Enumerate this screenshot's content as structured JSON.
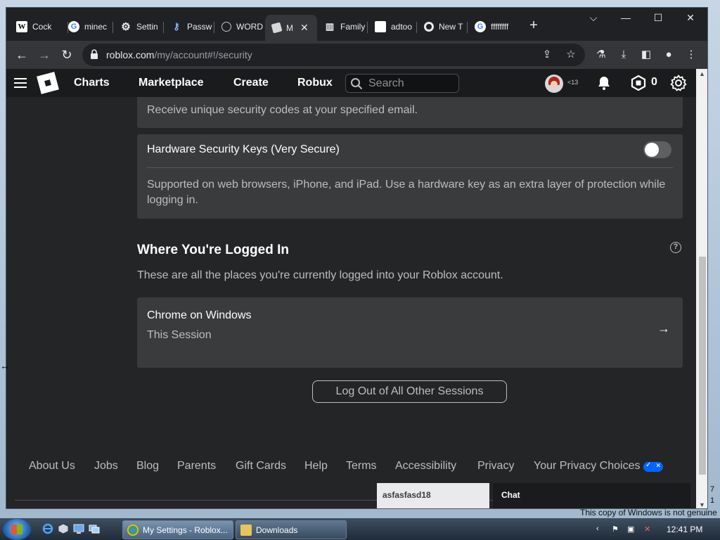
{
  "browser": {
    "tabs": [
      {
        "label": "Cock",
        "icon": "wikipedia-icon"
      },
      {
        "label": "minec",
        "icon": "google-icon"
      },
      {
        "label": "Settin",
        "icon": "gear-icon"
      },
      {
        "label": "Passw",
        "icon": "key-icon"
      },
      {
        "label": "WORD",
        "icon": "globe-icon"
      },
      {
        "label": "M",
        "icon": "roblox-icon",
        "active": true
      },
      {
        "label": "Family",
        "icon": "building-icon"
      },
      {
        "label": "adtoo",
        "icon": "blank-page-icon"
      },
      {
        "label": "New T",
        "icon": "chrome-icon"
      },
      {
        "label": "ffffffff",
        "icon": "google-icon"
      }
    ],
    "url_host": "roblox.com",
    "url_path": "/my/account#!/security"
  },
  "header": {
    "nav": [
      "Charts",
      "Marketplace",
      "Create",
      "Robux"
    ],
    "search_placeholder": "Search",
    "age_label": "<13",
    "robux_count": "0"
  },
  "security": {
    "email_desc": "Receive unique security codes at your specified email.",
    "hardware_title": "Hardware Security Keys (Very Secure)",
    "hardware_desc_line1": "Supported on web browsers, iPhone, and iPad. Use a hardware key as an extra layer of protection while",
    "hardware_desc_line2": "logging in.",
    "hardware_enabled": false
  },
  "sessions": {
    "title": "Where You're Logged In",
    "help_glyph": "?",
    "description": "These are all the places you're currently logged into your Roblox account.",
    "items": [
      {
        "device": "Chrome on Windows",
        "note": "This Session"
      }
    ],
    "logout_label": "Log Out of All Other Sessions"
  },
  "footer": {
    "links": [
      "About Us",
      "Jobs",
      "Blog",
      "Parents",
      "Gift Cards",
      "Help",
      "Terms",
      "Accessibility",
      "Privacy",
      "Your Privacy Choices"
    ]
  },
  "chat": {
    "username": "asfasfasd18",
    "label": "Chat"
  },
  "taskbar": {
    "tasks": [
      "My Settings - Roblox...",
      "Downloads"
    ],
    "time": "12:41 PM",
    "watermark": "This copy of Windows is not genuine",
    "side_numbers": [
      "7",
      "1"
    ]
  },
  "colors": {
    "page_bg": "#232527",
    "card_bg": "#393b3d",
    "header_bg": "#191b1d",
    "text_muted": "#bdbebe",
    "privacy_blue": "#0066ff"
  }
}
